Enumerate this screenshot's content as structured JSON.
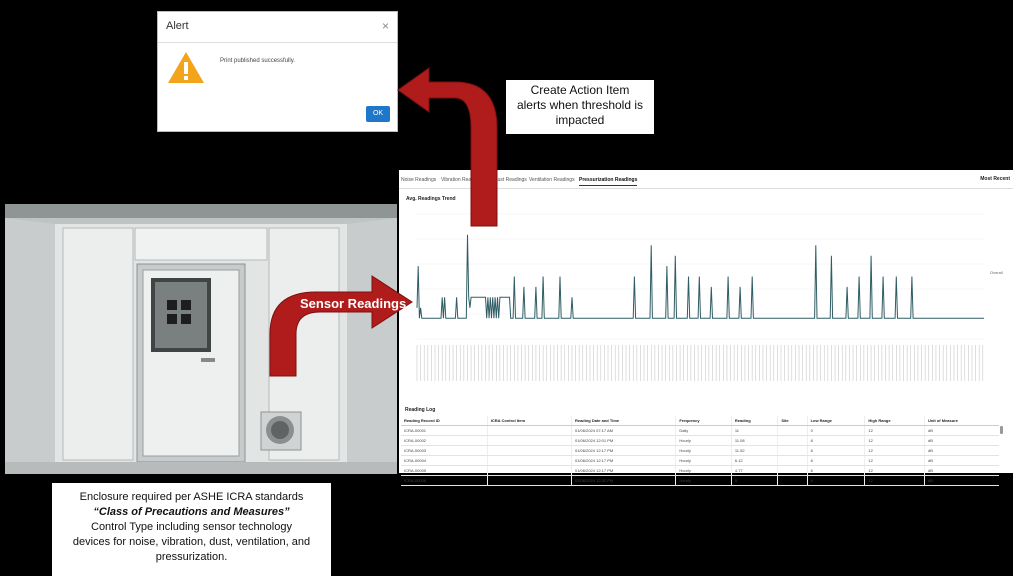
{
  "alert": {
    "title": "Alert",
    "close": "×",
    "message": "Print published successfully.",
    "ok_label": "OK",
    "icon": "warning-icon"
  },
  "callout_top": {
    "line1": "Create Action Item",
    "line2": "alerts when threshold is",
    "line3": "impacted"
  },
  "sensor_label": "Sensor Readings",
  "callout_bottom": {
    "line1": "Enclosure required per ASHE ICRA standards",
    "line2": "“Class of Precautions and Measures”",
    "line3": "Control Type including sensor technology",
    "line4": "devices for noise, vibration, dust, ventilation, and",
    "line5": "pressurization."
  },
  "dashboard": {
    "tabs": [
      "Noise Readings",
      "Vibration Readings",
      "Dust Readings",
      "Ventilation Readings",
      "Pressurization Readings"
    ],
    "active_tab": 4,
    "menu": "Most Recent",
    "card_title": "Avg. Readings Trend",
    "legend": "Overall",
    "table_title": "Reading Log",
    "columns": [
      "Reading Record ID",
      "ICRA Control Item",
      "Reading Date and Time",
      "Frequency",
      "Reading",
      "Site",
      "Low Range",
      "High Range",
      "Unit of Measure"
    ],
    "rows": [
      [
        "ICRA-00001",
        "",
        "01/06/2024 07:17 AM",
        "Daily",
        "11",
        "",
        "0",
        "12",
        "dB"
      ],
      [
        "ICRA-00002",
        "",
        "01/06/2024 12:01 PM",
        "Hourly",
        "11.08",
        "",
        "6",
        "12",
        "dB"
      ],
      [
        "ICRA-00003",
        "",
        "01/06/2024 12:17 PM",
        "Hourly",
        "11.52",
        "",
        "6",
        "12",
        "dB"
      ],
      [
        "ICRA-00004",
        "",
        "01/06/2024 12:17 PM",
        "Hourly",
        "6.12",
        "",
        "6",
        "12",
        "dB"
      ],
      [
        "ICRA-00005",
        "",
        "01/06/2024 12:17 PM",
        "Hourly",
        "4.77",
        "",
        "6",
        "12",
        "dB"
      ],
      [
        "ICRA-00006",
        "",
        "01/06/2024 12:32 PM",
        "Hourly",
        "5",
        "",
        "6",
        "12",
        "dB"
      ]
    ],
    "colors": {
      "line": "#2f5d64",
      "arrow": "#b01c1c"
    }
  },
  "chart_data": {
    "type": "line",
    "title": "Avg. Readings Trend",
    "xlabel": "",
    "ylabel": "",
    "series": [
      {
        "name": "Overall",
        "values": [
          6,
          10,
          5,
          6,
          5,
          5,
          5,
          5,
          5,
          5,
          5,
          5,
          5,
          5,
          5,
          5,
          5,
          5,
          5,
          5,
          5,
          7,
          5,
          7,
          5,
          5,
          5,
          5,
          5,
          5,
          5,
          5,
          5,
          7,
          5,
          5,
          5,
          5,
          5,
          5,
          5,
          5,
          13,
          7,
          6,
          7,
          7,
          7,
          7,
          7,
          7,
          7,
          7,
          7,
          7,
          7,
          7,
          7,
          5,
          7,
          5,
          7,
          5,
          7,
          5,
          7,
          5,
          7,
          5,
          7,
          7,
          7,
          7,
          7,
          7,
          7,
          7,
          7,
          5,
          5,
          5,
          9,
          5,
          5,
          5,
          5,
          5,
          5,
          5,
          8,
          5,
          5,
          5,
          5,
          5,
          5,
          5,
          5,
          5,
          8,
          5,
          5,
          5,
          5,
          5,
          9,
          5,
          5,
          5,
          5,
          5,
          5,
          5,
          5,
          5,
          5,
          5,
          5,
          5,
          9,
          5,
          5,
          5,
          5,
          5,
          5,
          5,
          5,
          5,
          7,
          5,
          5,
          5,
          5,
          5,
          5,
          5,
          5,
          5,
          5,
          5,
          5,
          5,
          5,
          5,
          5,
          5,
          5,
          5,
          5,
          5,
          5,
          5,
          5,
          5,
          5,
          5,
          5,
          5,
          5,
          5,
          5,
          5,
          5,
          5,
          5,
          5,
          5,
          5,
          5,
          5,
          5,
          5,
          5,
          5,
          5,
          5,
          5,
          5,
          5,
          5,
          9,
          5,
          5,
          5,
          5,
          5,
          5,
          5,
          5,
          5,
          5,
          5,
          5,
          5,
          12,
          5,
          5,
          5,
          5,
          5,
          5,
          5,
          5,
          5,
          5,
          5,
          5,
          10,
          5,
          5,
          5,
          5,
          5,
          5,
          11,
          5,
          5,
          5,
          5,
          5,
          5,
          5,
          5,
          5,
          5,
          9,
          5,
          5,
          5,
          5,
          5,
          5,
          5,
          5,
          9,
          5,
          5,
          5,
          5,
          5,
          5,
          5,
          5,
          5,
          8,
          5,
          5,
          5,
          5,
          5,
          5,
          5,
          5,
          5,
          5,
          5,
          5,
          5,
          9,
          5,
          5,
          5,
          5,
          5,
          5,
          5,
          5,
          5,
          8,
          5,
          5,
          5,
          5,
          5,
          5,
          5,
          5,
          5,
          9,
          5,
          5,
          5,
          5,
          5,
          5,
          5,
          5,
          5,
          5,
          5,
          5,
          5,
          5,
          5,
          5,
          5,
          5,
          5,
          5,
          5,
          5,
          5,
          5,
          5,
          5,
          5,
          5,
          5,
          5,
          5,
          5,
          5,
          5,
          5,
          5,
          5,
          5,
          5,
          5,
          5,
          5,
          5,
          5,
          5,
          5,
          5,
          5,
          5,
          5,
          5,
          5,
          12,
          5,
          5,
          5,
          5,
          5,
          5,
          5,
          5,
          5,
          5,
          5,
          5,
          11,
          5,
          5,
          5,
          5,
          5,
          5,
          5,
          5,
          5,
          5,
          5,
          5,
          8,
          5,
          5,
          5,
          5,
          5,
          5,
          5,
          5,
          5,
          9,
          5,
          5,
          5,
          5,
          5,
          5,
          5,
          5,
          5,
          11,
          5,
          5,
          5,
          5,
          5,
          5,
          5,
          5,
          5,
          9,
          5,
          5,
          5,
          5,
          5,
          5,
          5,
          5,
          5,
          5,
          9,
          5,
          5,
          5,
          5,
          5,
          5,
          5,
          5,
          5,
          5,
          5,
          5,
          9,
          5,
          5,
          5,
          5,
          5,
          5,
          5,
          5,
          5,
          5,
          5,
          5,
          5,
          5,
          5,
          5,
          5,
          5,
          5,
          5,
          5,
          5,
          5,
          5,
          5,
          5,
          5,
          5,
          5,
          5,
          5,
          5,
          5,
          5,
          5,
          5,
          5,
          5,
          5,
          5,
          5,
          5,
          5,
          5,
          5,
          5,
          5,
          5,
          5,
          5,
          5,
          5,
          5,
          5,
          5,
          5,
          5,
          5,
          5,
          5
        ]
      }
    ],
    "ylim": [
      3,
      15
    ]
  }
}
